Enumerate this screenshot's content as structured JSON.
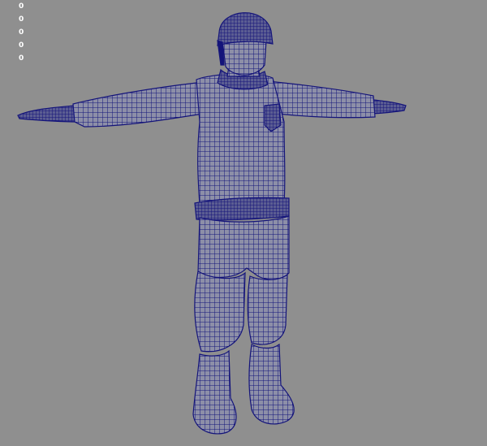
{
  "viewport": {
    "background_color": "#8f8f8f",
    "wireframe_color": "#14147a",
    "hud": {
      "stats": [
        "0",
        "0",
        "0",
        "0",
        "0"
      ]
    }
  }
}
